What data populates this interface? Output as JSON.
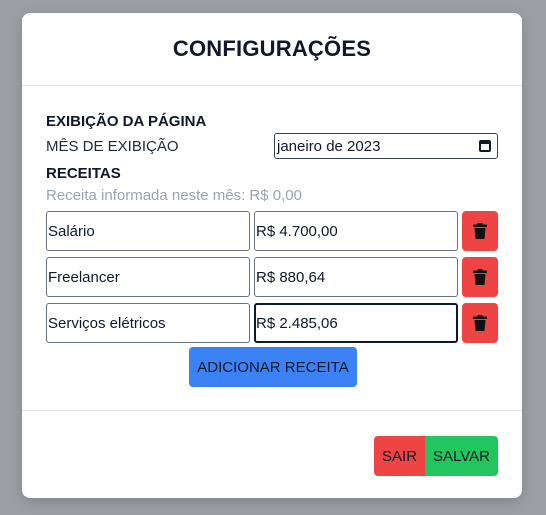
{
  "modal": {
    "title": "CONFIGURAÇÕES"
  },
  "display_section": {
    "title": "EXIBIÇÃO DA PÁGINA",
    "month_label": "MÊS DE EXIBIÇÃO",
    "month_value": "janeiro de 2023",
    "month_icon": "calendar-icon"
  },
  "income_section": {
    "title": "RECEITAS",
    "info": "Receita informada neste mês: R$ 0,00",
    "items": [
      {
        "name": "Salário",
        "value": "R$ 4.700,00",
        "icon": "trash-icon"
      },
      {
        "name": "Freelancer",
        "value": "R$ 880,64",
        "icon": "trash-icon"
      },
      {
        "name": "Serviços elétricos",
        "value": "R$ 2.485,06",
        "icon": "trash-icon"
      }
    ],
    "add_label": "ADICIONAR RECEITA"
  },
  "footer": {
    "exit_label": "SAIR",
    "save_label": "SALVAR"
  },
  "colors": {
    "overlay": "#9ca0a5",
    "danger": "#ef4444",
    "primary": "#3b82f6",
    "success": "#22c55e"
  }
}
